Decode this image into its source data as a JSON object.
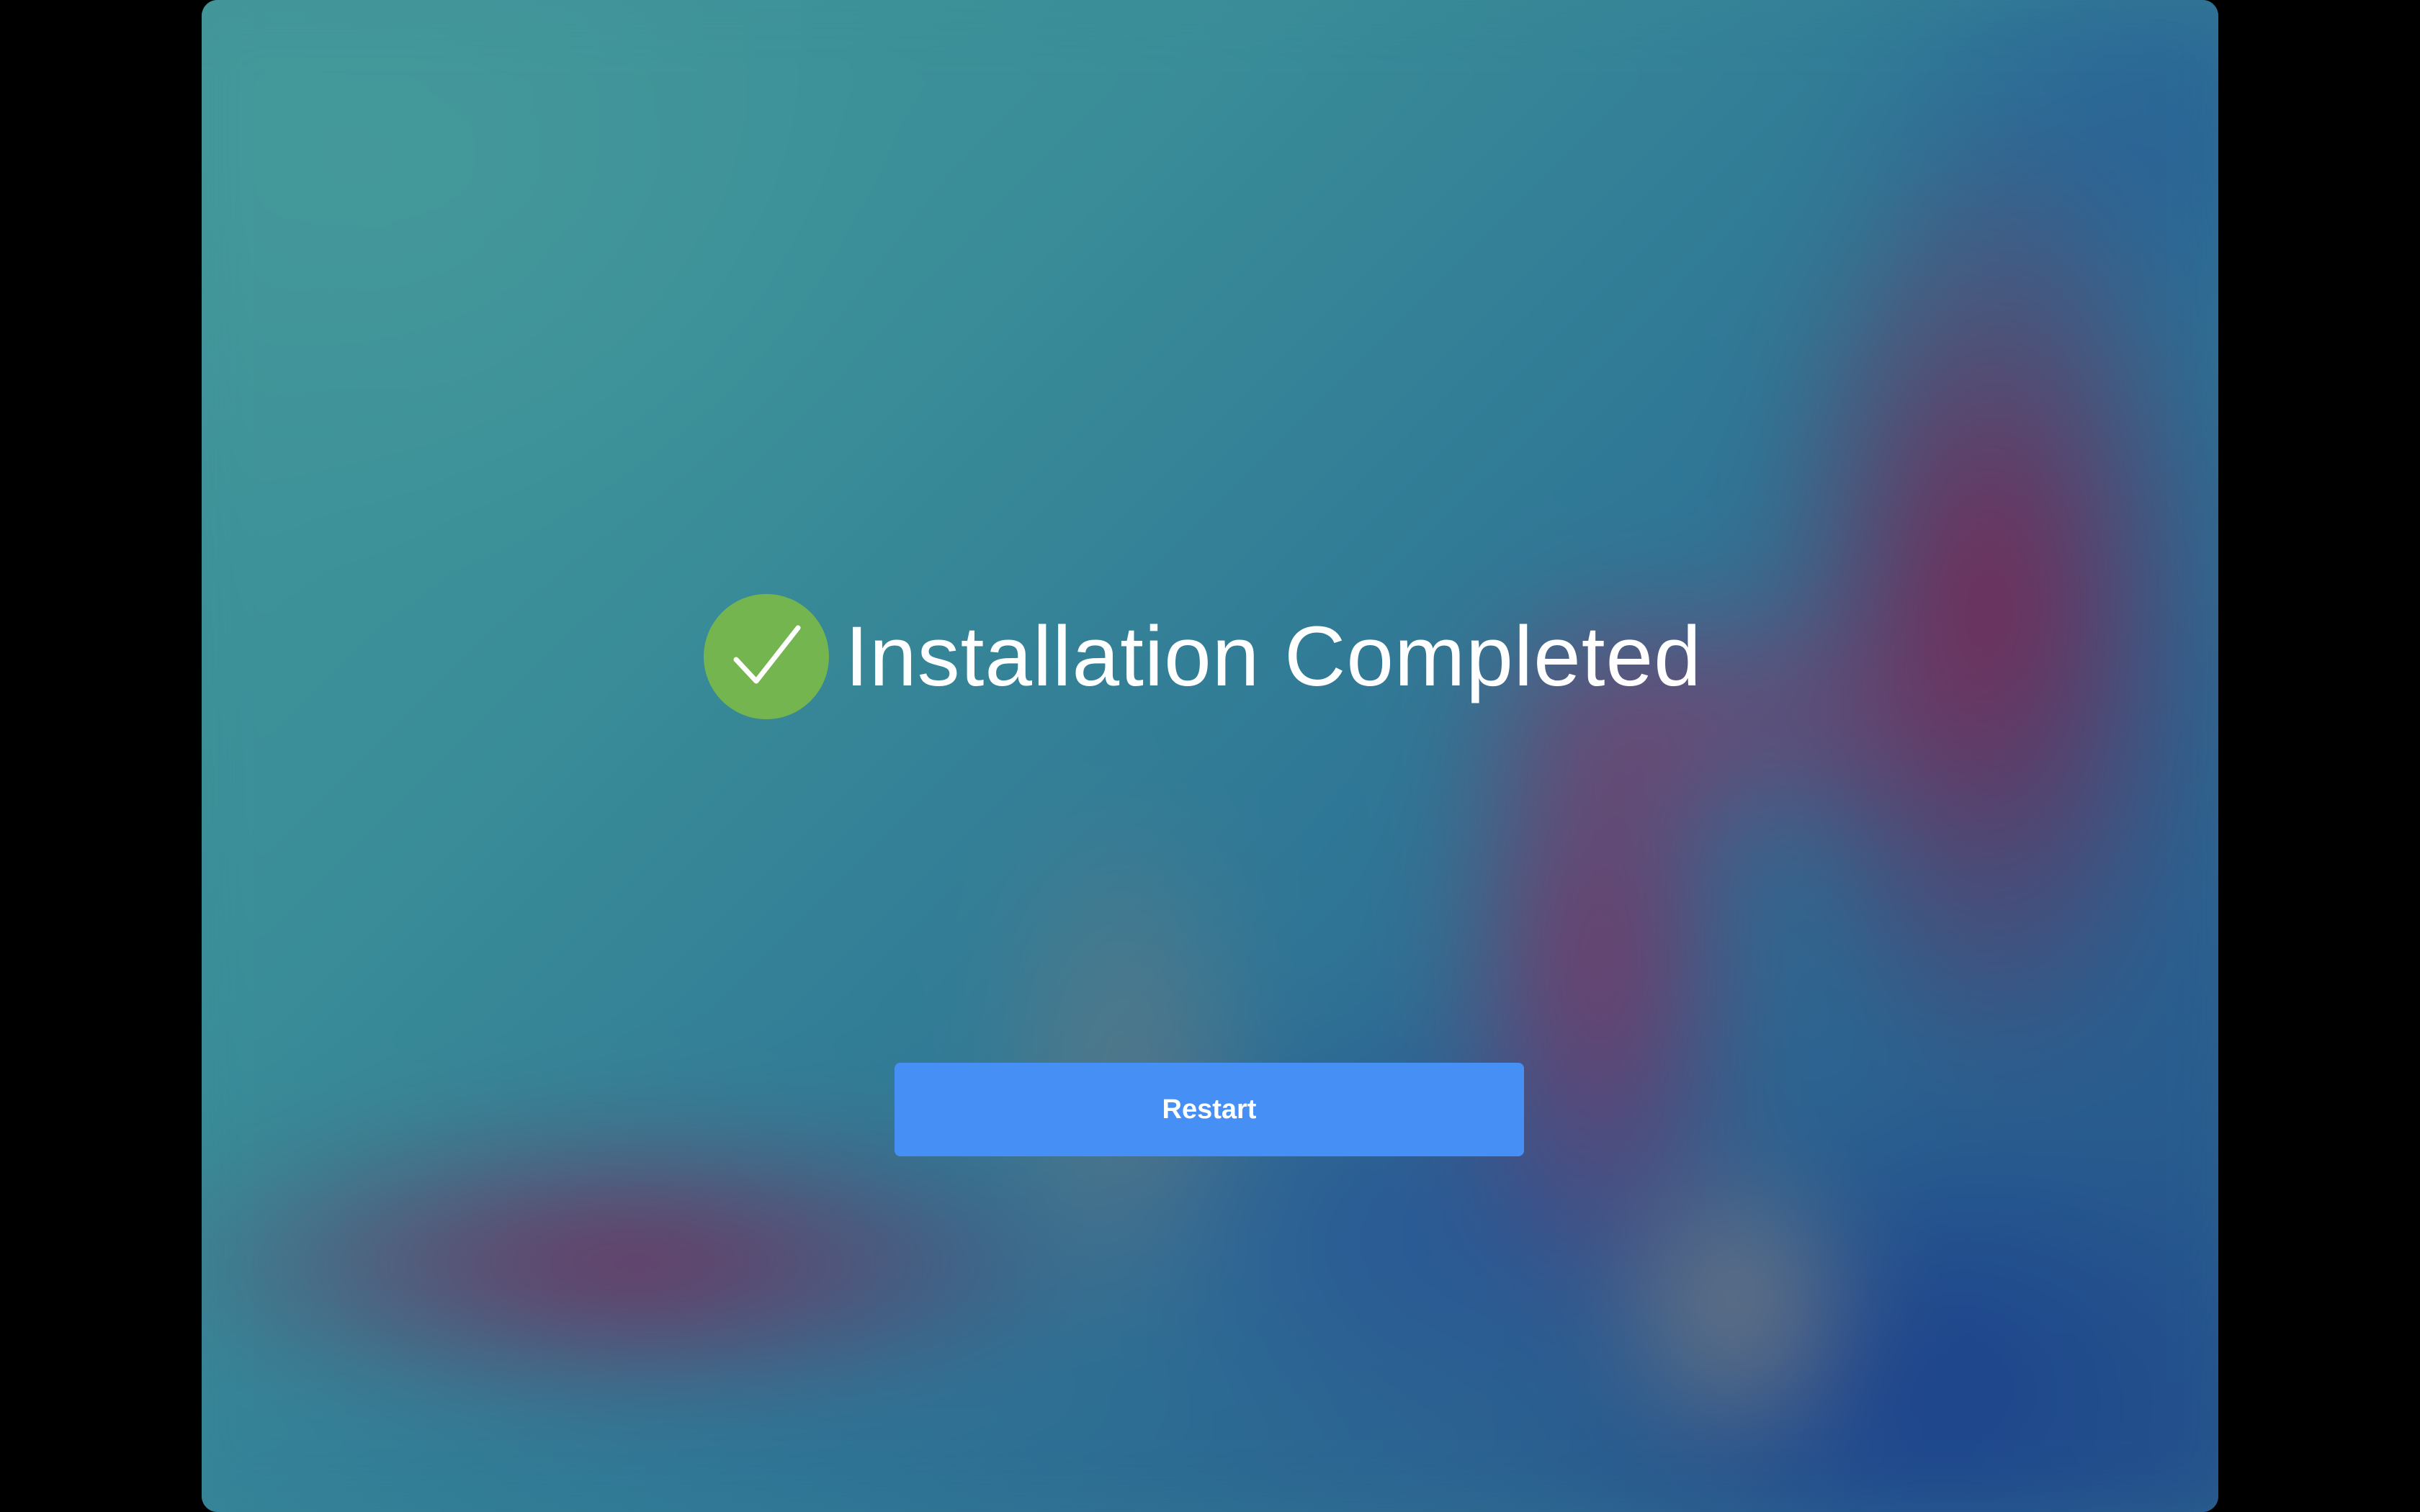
{
  "installer": {
    "title": "Installation Completed",
    "status_icon": "check-circle-icon",
    "restart_label": "Restart"
  },
  "colors": {
    "check_badge": "#74b54f",
    "button": "#4690f5",
    "text": "#ffffff"
  }
}
